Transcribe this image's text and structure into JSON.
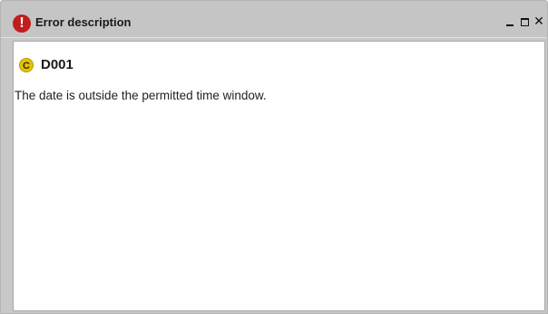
{
  "window": {
    "title": "Error description",
    "title_icon": "error-exclamation-icon",
    "controls": {
      "minimize": "minimize-icon",
      "maximize": "maximize-icon",
      "close": "close-icon"
    }
  },
  "error": {
    "badge_letter": "C",
    "code": "D001",
    "description": "The date is outside the permitted time window."
  },
  "colors": {
    "title_icon_bg": "#c11d1d",
    "badge_bg": "#e6c200",
    "titlebar_bg": "#c5c5c5"
  }
}
